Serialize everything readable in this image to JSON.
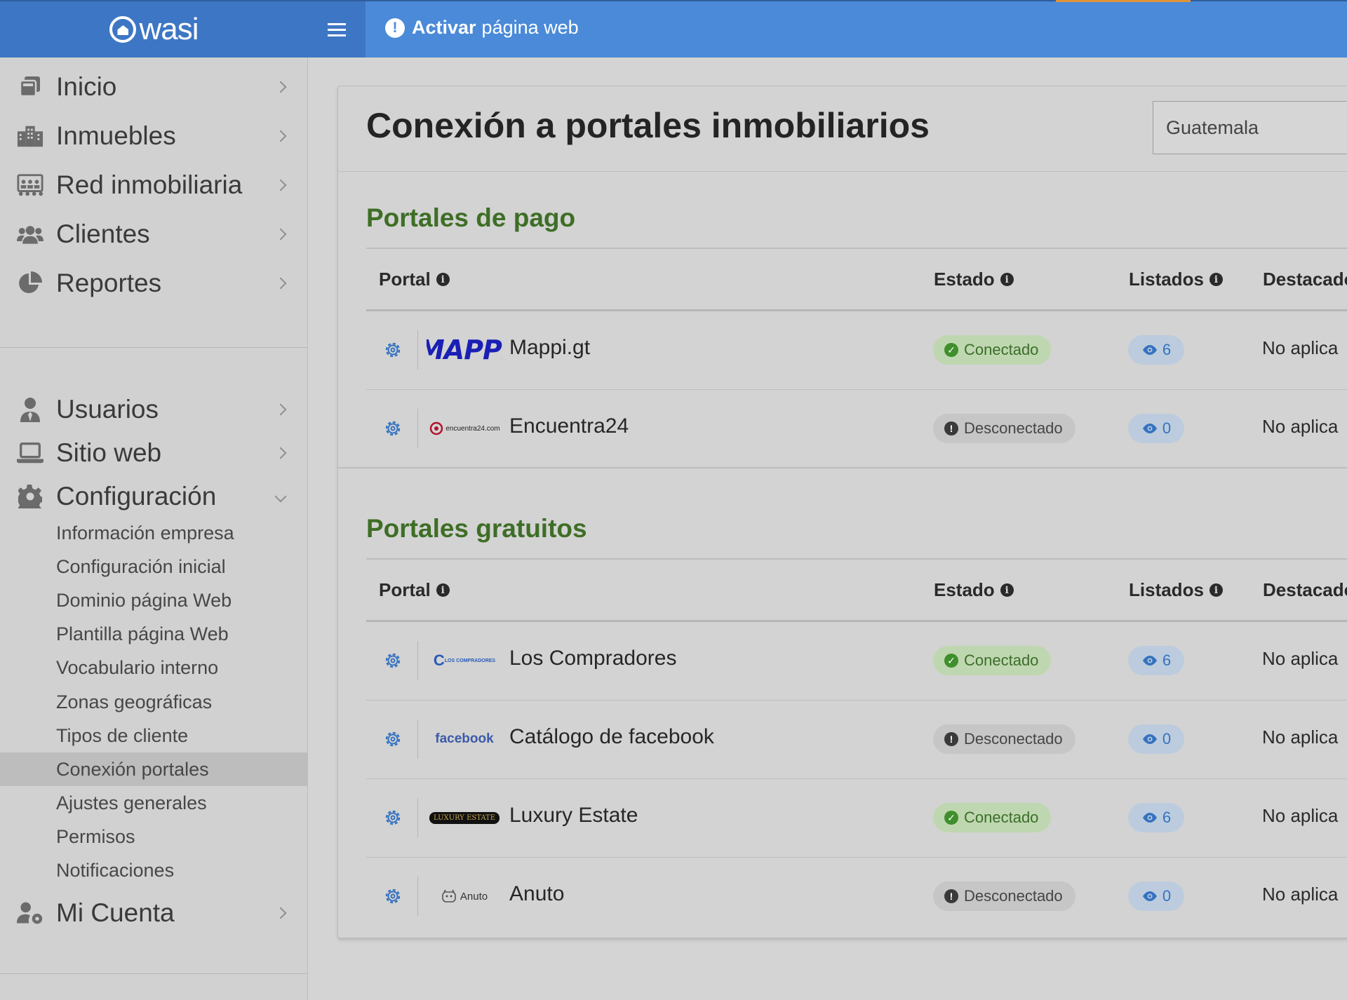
{
  "brand": {
    "name": "wasi"
  },
  "topbar": {
    "activar_bold": "Activar",
    "activar_rest": "página web"
  },
  "sidebar": {
    "main_items": [
      {
        "label": "Inicio",
        "icon": "copy-icon"
      },
      {
        "label": "Inmuebles",
        "icon": "buildings-icon"
      },
      {
        "label": "Red inmobiliaria",
        "icon": "network-icon"
      },
      {
        "label": "Clientes",
        "icon": "users-icon"
      },
      {
        "label": "Reportes",
        "icon": "pie-chart-icon"
      }
    ],
    "admin_items": [
      {
        "label": "Usuarios",
        "icon": "user-tie-icon"
      },
      {
        "label": "Sitio web",
        "icon": "laptop-icon"
      },
      {
        "label": "Configuración",
        "icon": "gear-icon"
      }
    ],
    "config_subitems": [
      "Información empresa",
      "Configuración inicial",
      "Dominio página Web",
      "Plantilla página Web",
      "Vocabulario interno",
      "Zonas geográficas",
      "Tipos de cliente",
      "Conexión portales",
      "Ajustes generales",
      "Permisos",
      "Notificaciones"
    ],
    "active_subitem": "Conexión portales",
    "account_item": {
      "label": "Mi Cuenta",
      "icon": "user-gear-icon"
    }
  },
  "page": {
    "title": "Conexión a portales inmobiliarios",
    "country_select": {
      "value": "Guatemala"
    }
  },
  "table_headers": {
    "portal": "Portal",
    "estado": "Estado",
    "listados": "Listados",
    "destacados": "Destacado"
  },
  "sections": [
    {
      "title": "Portales de pago",
      "rows": [
        {
          "logo": "MAPPI",
          "name": "Mappi.gt",
          "status": "Conectado",
          "connected": true,
          "listados": "6",
          "destacados": "No aplica"
        },
        {
          "logo": "encuentra24.com",
          "name": "Encuentra24",
          "status": "Desconectado",
          "connected": false,
          "listados": "0",
          "destacados": "No aplica"
        }
      ]
    },
    {
      "title": "Portales gratuitos",
      "rows": [
        {
          "logo": "LOS COMPRADORES",
          "name": "Los Compradores",
          "status": "Conectado",
          "connected": true,
          "listados": "6",
          "destacados": "No aplica"
        },
        {
          "logo": "facebook",
          "name": "Catálogo de facebook",
          "status": "Desconectado",
          "connected": false,
          "listados": "0",
          "destacados": "No aplica"
        },
        {
          "logo": "LUXURY ESTATE",
          "name": "Luxury Estate",
          "status": "Conectado",
          "connected": true,
          "listados": "6",
          "destacados": "No aplica"
        },
        {
          "logo": "Anuto",
          "name": "Anuto",
          "status": "Desconectado",
          "connected": false,
          "listados": "0",
          "destacados": "No aplica"
        }
      ]
    }
  ],
  "colors": {
    "topbar": "#4a8ad8",
    "logo_bg": "#3d76c4",
    "section_title": "#3e6e26",
    "connected_bg": "#bfd7b0",
    "count_text": "#3572c0"
  }
}
